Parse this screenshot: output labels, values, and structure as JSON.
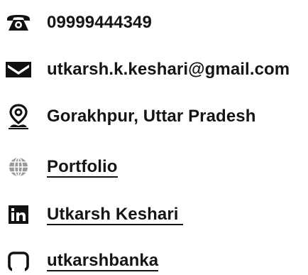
{
  "contacts": {
    "phone": {
      "icon": "telephone-icon",
      "text": "09999444349"
    },
    "email": {
      "icon": "envelope-icon",
      "text": "utkarsh.k.keshari@gmail.com"
    },
    "location": {
      "icon": "map-pin-icon",
      "text": "Gorakhpur, Uttar Pradesh"
    },
    "portfolio": {
      "icon": "globe-icon",
      "text": "Portfolio"
    },
    "linkedin": {
      "icon": "linkedin-icon",
      "text": "Utkarsh Keshari "
    },
    "github": {
      "icon": "github-icon",
      "text": "utkarshbanka"
    }
  },
  "colors": {
    "text": "#151515",
    "icon": "#111111",
    "icon_gray": "#9a9a9a"
  }
}
